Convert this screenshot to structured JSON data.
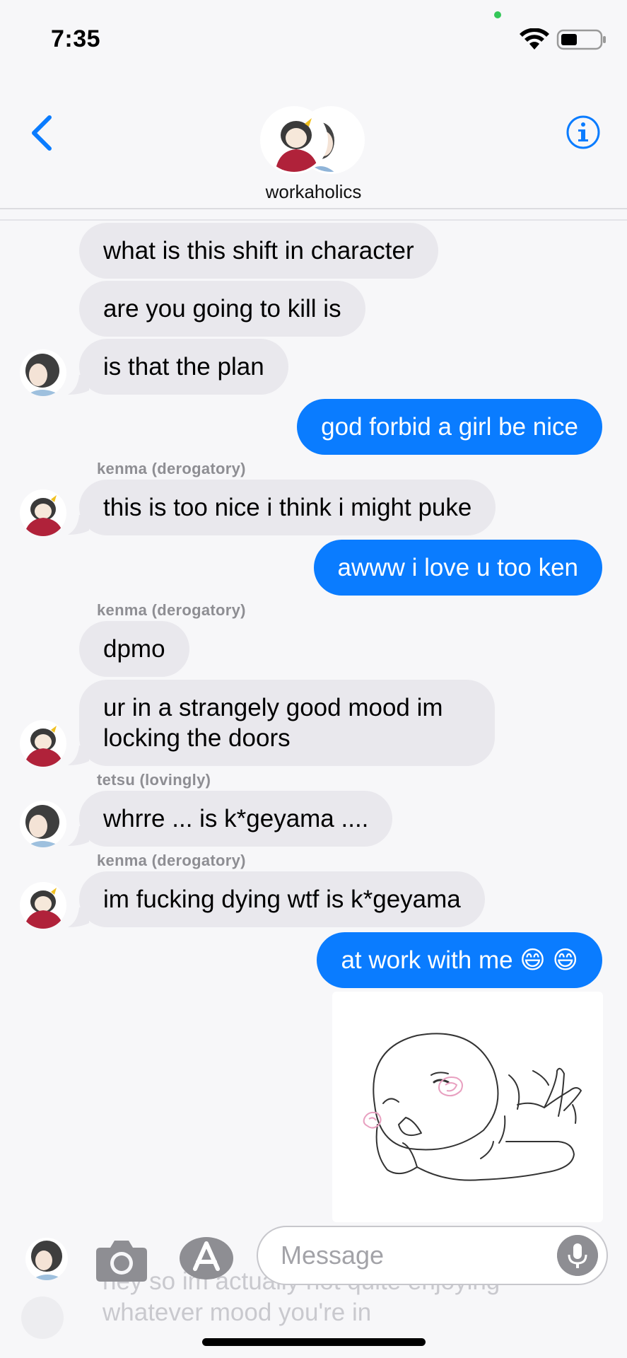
{
  "status_bar": {
    "time": "7:35"
  },
  "header": {
    "title": "workaholics"
  },
  "messages": [
    {
      "text": "what is this shift in character"
    },
    {
      "text": "are you going to kill is"
    },
    {
      "text": "is that the plan"
    },
    {
      "text": "god forbid a girl be nice"
    },
    {
      "sender": "kenma (derogatory)",
      "text": "this is too nice i think i might puke"
    },
    {
      "text": "awww i love u too ken"
    },
    {
      "sender": "kenma (derogatory)",
      "text": "dpmo"
    },
    {
      "text": "ur in a strangely good mood im",
      "text2": "locking the doors"
    },
    {
      "sender": "tetsu (lovingly)",
      "text": "whrre ... is k*geyama ...."
    },
    {
      "sender": "kenma (derogatory)",
      "text": "im fucking dying wtf is k*geyama"
    },
    {
      "text": "at work with me 😄 😄"
    }
  ],
  "composer": {
    "placeholder": "Message",
    "ghost_line1": "hey so im actually not quite enjoying",
    "ghost_line2": "whatever mood you're in"
  },
  "colors": {
    "accent": "#0a7cff",
    "incoming_bubble": "#e9e8ed",
    "sender_label": "#8e8e93"
  }
}
